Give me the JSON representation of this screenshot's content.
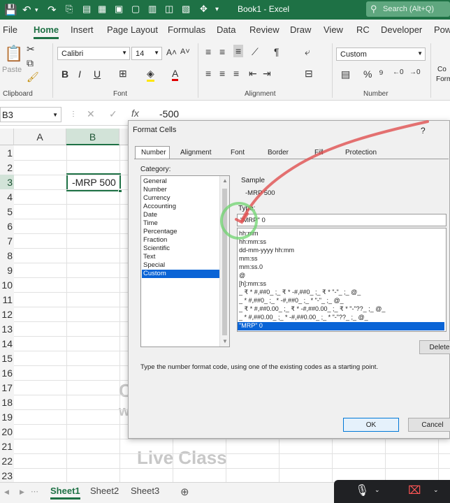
{
  "titlebar": {
    "title": "Book1 - Excel",
    "search_placeholder": "Search (Alt+Q)"
  },
  "menu_tabs": [
    "File",
    "Home",
    "Insert",
    "Page Layout",
    "Formulas",
    "Data",
    "Review",
    "Draw",
    "View",
    "RC",
    "Developer",
    "Pow"
  ],
  "ribbon": {
    "paste_label": "Paste",
    "font_name": "Calibri",
    "font_size": "14",
    "number_format": "Custom",
    "groups": {
      "clipboard": "Clipboard",
      "font": "Font",
      "alignment": "Alignment",
      "number": "Number"
    },
    "styles_partial": [
      "Co",
      "Form"
    ]
  },
  "formula_bar": {
    "name_box": "B3",
    "fx": "fx",
    "value": "-500"
  },
  "grid": {
    "columns": [
      "A",
      "B"
    ],
    "rows": [
      "1",
      "2",
      "3",
      "4",
      "5",
      "6",
      "7",
      "8",
      "9",
      "10",
      "11",
      "12",
      "13",
      "14",
      "15",
      "16",
      "17",
      "18",
      "19",
      "20",
      "21",
      "22",
      "23"
    ],
    "selected_cell_value": "-MRP 500"
  },
  "watermark": {
    "line1": "C",
    "line2": "w",
    "line3": "Live Class"
  },
  "sheets": [
    "Sheet1",
    "Sheet2",
    "Sheet3"
  ],
  "dialog": {
    "title": "Format Cells",
    "help": "?",
    "tabs": [
      "Number",
      "Alignment",
      "Font",
      "Border",
      "Fill",
      "Protection"
    ],
    "category_label": "Category:",
    "categories": [
      "General",
      "Number",
      "Currency",
      "Accounting",
      "Date",
      "Time",
      "Percentage",
      "Fraction",
      "Scientific",
      "Text",
      "Special",
      "Custom"
    ],
    "selected_category": "Custom",
    "sample_label": "Sample",
    "sample_value": "-MRP 500",
    "type_label": "Type:",
    "type_value": "\"MRP\" 0",
    "type_list": [
      "hh:mm",
      "hh:mm:ss",
      "dd-mm-yyyy hh:mm",
      "mm:ss",
      "mm:ss.0",
      "@",
      "[h]:mm:ss",
      "_ ₹ * #,##0_ ;_ ₹ * -#,##0_ ;_ ₹ * \"-\"_ ;_ @_",
      "_ * #,##0_ ;_ * -#,##0_ ;_ * \"-\"_ ;_ @_",
      "_ ₹ * #,##0.00_ ;_ ₹ * -#,##0.00_ ;_ ₹ * \"-\"??_ ;_ @_",
      "_ * #,##0.00_ ;_ * -#,##0.00_ ;_ * \"-\"??_ ;_ @_",
      "\"MRP\" 0"
    ],
    "selected_type": "\"MRP\" 0",
    "delete_label": "Delete",
    "hint": "Type the number format code, using one of the existing codes as a starting point.",
    "ok_label": "OK",
    "cancel_label": "Cancel"
  }
}
